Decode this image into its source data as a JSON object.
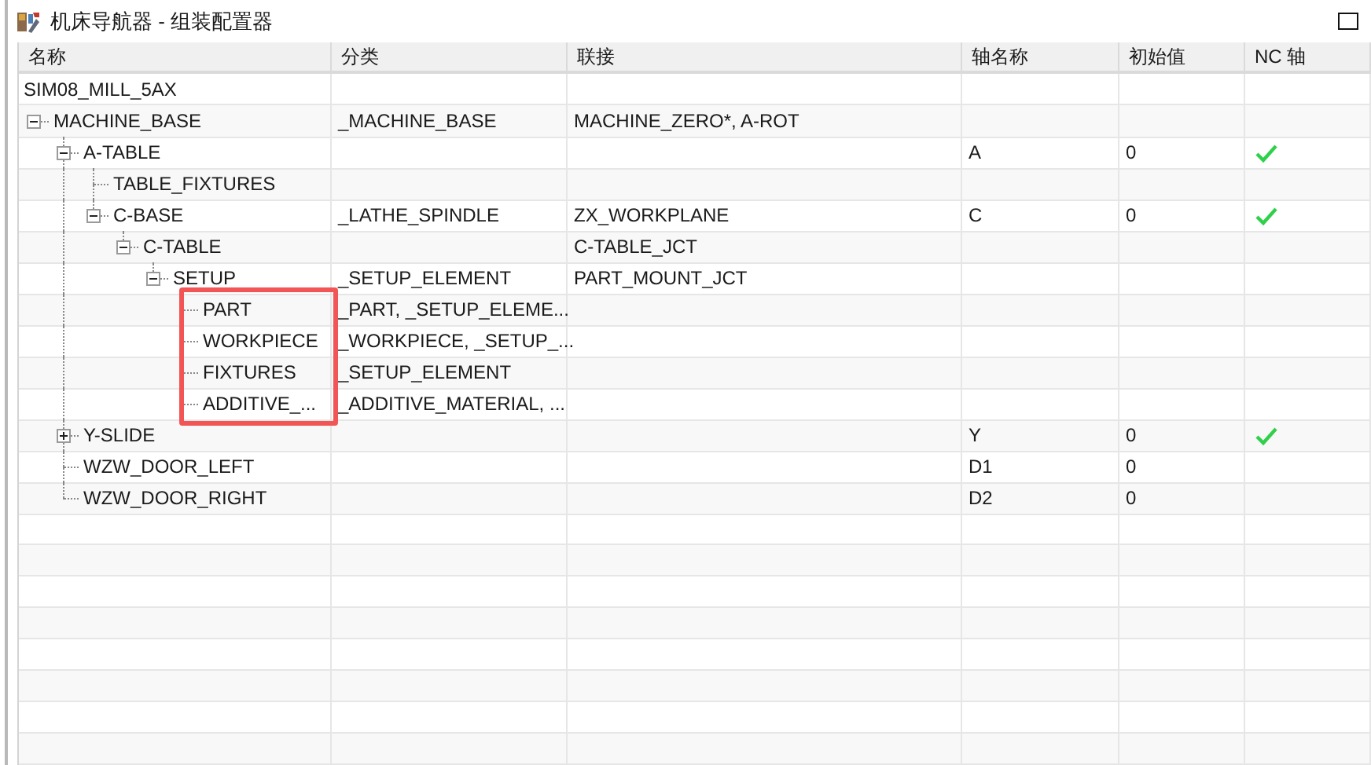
{
  "window": {
    "title": "机床导航器 - 组装配置器"
  },
  "table": {
    "columns": [
      "名称",
      "分类",
      "联接",
      "轴名称",
      "初始值",
      "NC 轴"
    ],
    "rows": [
      {
        "name": "SIM08_MILL_5AX",
        "children": [
          {
            "name": "MACHINE_BASE",
            "category": "_MACHINE_BASE",
            "link": "MACHINE_ZERO*, A-ROT",
            "expanded": true,
            "children": [
              {
                "name": "A-TABLE",
                "axis_name": "A",
                "initial_value": "0",
                "nc_axis": true,
                "expanded": true,
                "children": [
                  {
                    "name": "TABLE_FIXTURES"
                  },
                  {
                    "name": "C-BASE",
                    "category": "_LATHE_SPINDLE",
                    "link": "ZX_WORKPLANE",
                    "axis_name": "C",
                    "initial_value": "0",
                    "nc_axis": true,
                    "expanded": true,
                    "children": [
                      {
                        "name": "C-TABLE",
                        "link": "C-TABLE_JCT",
                        "expanded": true,
                        "children": [
                          {
                            "name": "SETUP",
                            "category": "_SETUP_ELEMENT",
                            "link": "PART_MOUNT_JCT",
                            "expanded": true,
                            "children": [
                              {
                                "name": "PART",
                                "category": "_PART, _SETUP_ELEME...",
                                "highlighted": true
                              },
                              {
                                "name": "WORKPIECE",
                                "category": "_WORKPIECE, _SETUP_...",
                                "highlighted": true
                              },
                              {
                                "name": "FIXTURES",
                                "category": "_SETUP_ELEMENT",
                                "highlighted": true
                              },
                              {
                                "name": "ADDITIVE_...",
                                "category": "_ADDITIVE_MATERIAL, ...",
                                "highlighted": true
                              }
                            ]
                          }
                        ]
                      }
                    ]
                  }
                ]
              },
              {
                "name": "Y-SLIDE",
                "axis_name": "Y",
                "initial_value": "0",
                "nc_axis": true,
                "expanded": false
              },
              {
                "name": "WZW_DOOR_LEFT",
                "axis_name": "D1",
                "initial_value": "0"
              },
              {
                "name": "WZW_DOOR_RIGHT",
                "axis_name": "D2",
                "initial_value": "0"
              }
            ]
          }
        ]
      }
    ]
  }
}
